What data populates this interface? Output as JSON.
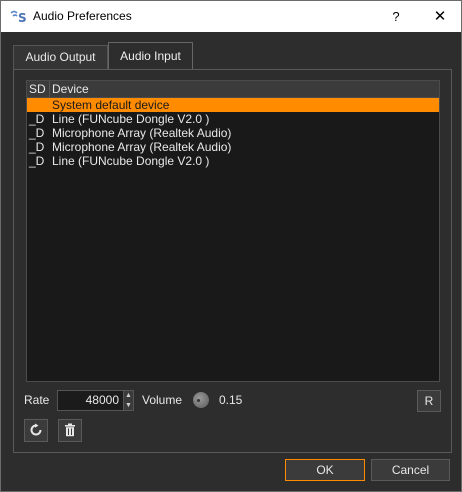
{
  "window": {
    "title": "Audio Preferences",
    "help_glyph": "?",
    "close_glyph": "✕"
  },
  "tabs": [
    {
      "label": "Audio Output",
      "active": false
    },
    {
      "label": "Audio Input",
      "active": true
    }
  ],
  "device_table": {
    "headers": {
      "sd": "SD",
      "device": "Device"
    },
    "rows": [
      {
        "sd": "",
        "device": "System default device",
        "selected": true
      },
      {
        "sd": "_D",
        "device": "Line (FUNcube Dongle V2.0  )",
        "selected": false
      },
      {
        "sd": "_D",
        "device": "Microphone Array (Realtek Audio)",
        "selected": false
      },
      {
        "sd": "_D",
        "device": "Microphone Array (Realtek Audio)",
        "selected": false
      },
      {
        "sd": "_D",
        "device": "Line (FUNcube Dongle V2.0  )",
        "selected": false
      }
    ]
  },
  "controls": {
    "rate_label": "Rate",
    "rate_value": "48000",
    "volume_label": "Volume",
    "volume_value": "0.15",
    "reset_button": "R"
  },
  "icons": {
    "refresh": "refresh-icon",
    "delete": "trash-icon"
  },
  "buttons": {
    "ok": "OK",
    "cancel": "Cancel"
  },
  "colors": {
    "selection": "#ff8c00",
    "background": "#2d2d2d"
  }
}
